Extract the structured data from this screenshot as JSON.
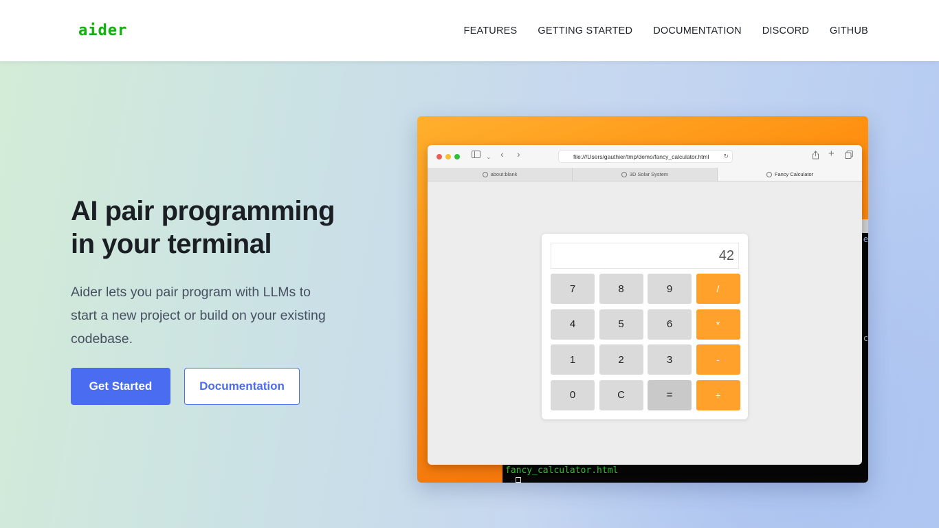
{
  "header": {
    "logo": "aider",
    "nav": [
      "FEATURES",
      "GETTING STARTED",
      "DOCUMENTATION",
      "DISCORD",
      "GITHUB"
    ]
  },
  "hero": {
    "headline_line1": "AI pair programming",
    "headline_line2": "in your terminal",
    "subtext": "Aider lets you pair program with LLMs to start a new project or build on your existing codebase.",
    "cta_primary": "Get Started",
    "cta_secondary": "Documentation"
  },
  "demo": {
    "browser": {
      "url": "file:///Users/gauthier/tmp/demo/fancy_calculator.html",
      "tabs": [
        "about:blank",
        "3D Solar System",
        "Fancy Calculator"
      ],
      "active_tab": "Fancy Calculator"
    },
    "calculator": {
      "display": "42",
      "keys": [
        "7",
        "8",
        "9",
        "/",
        "4",
        "5",
        "6",
        "*",
        "1",
        "2",
        "3",
        "-",
        "0",
        "C",
        "=",
        "+"
      ]
    },
    "terminal": {
      "line": "fancy_calculator.html"
    }
  },
  "colors": {
    "brand_green": "#14b014",
    "primary_blue": "#4a6cf0",
    "operator_orange": "#ffa12a"
  }
}
